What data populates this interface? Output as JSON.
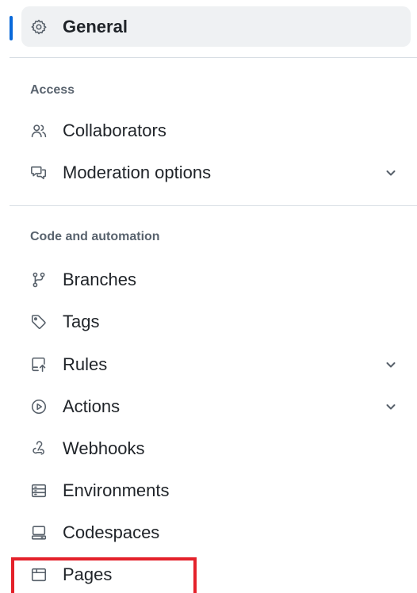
{
  "nav": {
    "general": {
      "label": "General",
      "icon": "gear-icon"
    },
    "access": {
      "heading": "Access",
      "items": [
        {
          "label": "Collaborators",
          "icon": "people-icon",
          "has_chevron": false
        },
        {
          "label": "Moderation options",
          "icon": "comment-discussion-icon",
          "has_chevron": true
        }
      ]
    },
    "code_automation": {
      "heading": "Code and automation",
      "items": [
        {
          "label": "Branches",
          "icon": "git-branch-icon",
          "has_chevron": false
        },
        {
          "label": "Tags",
          "icon": "tag-icon",
          "has_chevron": false
        },
        {
          "label": "Rules",
          "icon": "repo-push-icon",
          "has_chevron": true
        },
        {
          "label": "Actions",
          "icon": "play-icon",
          "has_chevron": true
        },
        {
          "label": "Webhooks",
          "icon": "webhook-icon",
          "has_chevron": false
        },
        {
          "label": "Environments",
          "icon": "server-icon",
          "has_chevron": false
        },
        {
          "label": "Codespaces",
          "icon": "codespaces-icon",
          "has_chevron": false
        },
        {
          "label": "Pages",
          "icon": "browser-icon",
          "has_chevron": false
        }
      ]
    }
  },
  "colors": {
    "accent": "#0969da",
    "highlight": "#e4212a",
    "active_bg": "#eff1f3",
    "divider": "#d8dee4",
    "muted_text": "#59636e"
  }
}
